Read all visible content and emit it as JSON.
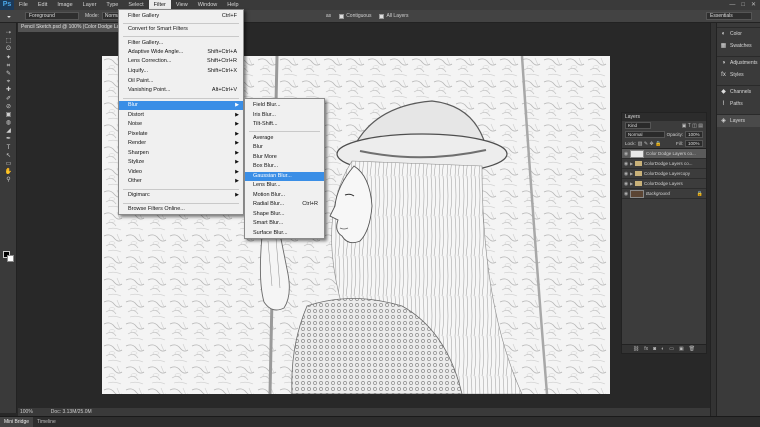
{
  "app": {
    "logo": "Ps",
    "menu": [
      "File",
      "Edit",
      "Image",
      "Layer",
      "Type",
      "Select",
      "Filter",
      "View",
      "Window",
      "Help"
    ],
    "active_menu": "Filter",
    "window_controls": [
      "—",
      "□",
      "✕"
    ]
  },
  "options_bar": {
    "preset": "Foreground",
    "mode_label": "Mode:",
    "mode_value": "Normal",
    "as_label": "as",
    "contiguous_label": "Contiguous",
    "all_layers_label": "All Layers",
    "workspace": "Essentials"
  },
  "document": {
    "tab_title": "Pencil Sketch.psd @ 100% (Color Dodge Lay"
  },
  "status": {
    "zoom": "100%",
    "doc_size": "Doc: 3.13M/25.0M"
  },
  "bottom_tabs": [
    "Mini Bridge",
    "Timeline"
  ],
  "dock": {
    "items": [
      {
        "icon": "◐",
        "label": "Color"
      },
      {
        "icon": "▦",
        "label": "Swatches"
      },
      {
        "icon": "◑",
        "label": "Adjustments"
      },
      {
        "icon": "fx",
        "label": "Styles"
      },
      {
        "icon": "◆",
        "label": "Channels"
      },
      {
        "icon": "⌇",
        "label": "Paths"
      },
      {
        "icon": "◈",
        "label": "Layers"
      }
    ]
  },
  "layers_panel": {
    "title": "Layers",
    "kind": "Kind",
    "blend_mode": "Normal",
    "opacity_label": "Opacity:",
    "opacity_value": "100%",
    "lock_label": "Lock:",
    "fill_label": "Fill:",
    "fill_value": "100%",
    "layers": [
      {
        "name": "Color Dodge Layers co...",
        "type": "layer",
        "selected": true
      },
      {
        "name": "ColorDodge Layers co...",
        "type": "group",
        "selected": false
      },
      {
        "name": "ColorDodge Layercopy",
        "type": "group",
        "selected": false
      },
      {
        "name": "ColorDodge Layers",
        "type": "group",
        "selected": false
      },
      {
        "name": "Background",
        "type": "background",
        "selected": false
      }
    ],
    "footer_icons": [
      "⛓",
      "fx",
      "◙",
      "◐",
      "▭",
      "▣",
      "🗑"
    ]
  },
  "filter_menu": {
    "items": [
      {
        "label": "Filter Gallery",
        "shortcut": "Ctrl+F"
      },
      {
        "label": "Convert for Smart Filters",
        "shortcut": ""
      },
      {
        "label": "Filter Gallery...",
        "shortcut": ""
      },
      {
        "label": "Adaptive Wide Angle...",
        "shortcut": "Shift+Ctrl+A"
      },
      {
        "label": "Lens Correction...",
        "shortcut": "Shift+Ctrl+R"
      },
      {
        "label": "Liquify...",
        "shortcut": "Shift+Ctrl+X"
      },
      {
        "label": "Oil Paint...",
        "shortcut": ""
      },
      {
        "label": "Vanishing Point...",
        "shortcut": "Alt+Ctrl+V"
      },
      {
        "label": "Blur",
        "shortcut": ""
      },
      {
        "label": "Distort",
        "shortcut": ""
      },
      {
        "label": "Noise",
        "shortcut": ""
      },
      {
        "label": "Pixelate",
        "shortcut": ""
      },
      {
        "label": "Render",
        "shortcut": ""
      },
      {
        "label": "Sharpen",
        "shortcut": ""
      },
      {
        "label": "Stylize",
        "shortcut": ""
      },
      {
        "label": "Video",
        "shortcut": ""
      },
      {
        "label": "Other",
        "shortcut": ""
      },
      {
        "label": "Digimarc",
        "shortcut": ""
      },
      {
        "label": "Browse Filters Online...",
        "shortcut": ""
      }
    ]
  },
  "blur_menu": {
    "items": [
      {
        "label": "Field Blur...",
        "shortcut": ""
      },
      {
        "label": "Iris Blur...",
        "shortcut": ""
      },
      {
        "label": "Tilt-Shift...",
        "shortcut": ""
      },
      {
        "label": "Average",
        "shortcut": ""
      },
      {
        "label": "Blur",
        "shortcut": ""
      },
      {
        "label": "Blur More",
        "shortcut": ""
      },
      {
        "label": "Box Blur...",
        "shortcut": ""
      },
      {
        "label": "Gaussian Blur...",
        "shortcut": ""
      },
      {
        "label": "Lens Blur...",
        "shortcut": ""
      },
      {
        "label": "Motion Blur...",
        "shortcut": ""
      },
      {
        "label": "Radial Blur...",
        "shortcut": "Ctrl+R"
      },
      {
        "label": "Shape Blur...",
        "shortcut": ""
      },
      {
        "label": "Smart Blur...",
        "shortcut": ""
      },
      {
        "label": "Surface Blur...",
        "shortcut": ""
      }
    ]
  },
  "tools": [
    "⇢",
    "⬚",
    "ʘ",
    "✦",
    "⌗",
    "✎",
    "⌖",
    "✚",
    "✐",
    "⊘",
    "▣",
    "◍",
    "◢",
    "✒",
    "T",
    "↖",
    "▭",
    "✋",
    "⚲"
  ]
}
